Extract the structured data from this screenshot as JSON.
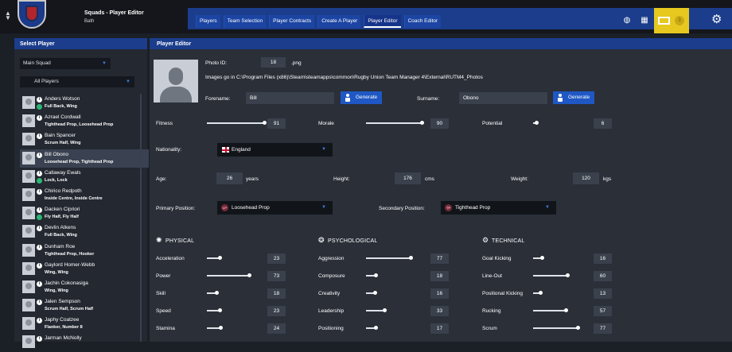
{
  "header": {
    "title": "Squads - Player Editor",
    "subtitle": "Bath"
  },
  "tabs": [
    {
      "label": "Players"
    },
    {
      "label": "Team Selection"
    },
    {
      "label": "Player Contracts"
    },
    {
      "label": "Create A Player"
    },
    {
      "label": "Player Editor"
    },
    {
      "label": "Coach Editor"
    }
  ],
  "notifications": {
    "count": "3"
  },
  "left_panel": {
    "title": "Select Player",
    "squad_select": "Main Squad",
    "filter_select": "All Players",
    "players": [
      {
        "name": "Anders Wotson",
        "positions": "Full Back, Wing"
      },
      {
        "name": "Azrael Cordwall",
        "positions": "Tighthead Prop, Loosehead Prop"
      },
      {
        "name": "Bain Spancer",
        "positions": "Scrum Half, Wing"
      },
      {
        "name": "Bill Obono",
        "positions": "Loosehead Prop, Tighthead Prop"
      },
      {
        "name": "Callaway Ewals",
        "positions": "Lock, Lock"
      },
      {
        "name": "Chirico Redpoth",
        "positions": "Inside Centre, Inside Centre"
      },
      {
        "name": "Dacken Cipriori",
        "positions": "Fly Half, Fly Half"
      },
      {
        "name": "Devlin Atkens",
        "positions": "Full Back, Wing"
      },
      {
        "name": "Dunham Roe",
        "positions": "Tighthead Prop, Hooker"
      },
      {
        "name": "Gaylord Homer-Webb",
        "positions": "Wing, Wing"
      },
      {
        "name": "Jachin Cokonasiga",
        "positions": "Wing, Wing"
      },
      {
        "name": "Jalen Sempson",
        "positions": "Scrum Half, Scrum Half"
      },
      {
        "name": "Japhy Coatzee",
        "positions": "Flanker, Number 8"
      },
      {
        "name": "Jarman McNolly",
        "positions": ""
      }
    ]
  },
  "editor": {
    "title": "Player Editor",
    "photo_id_label": "Photo ID:",
    "photo_id": "18",
    "photo_ext": ".png",
    "images_note": "Images go in C:\\Program Files (x86)\\Steam\\steamapps\\common\\Rugby Union Team Manager 4\\External\\RUTM4_Photos",
    "forename_label": "Forename:",
    "forename": "Bill",
    "surname_label": "Surname:",
    "surname": "Obono",
    "generate_label": "Generate",
    "fitness_label": "Fitness",
    "fitness": 91,
    "morale_label": "Morale",
    "morale": 90,
    "potential_label": "Potential",
    "potential": 6,
    "nationality_label": "Nationality:",
    "nationality": "England",
    "age_label": "Age:",
    "age": "26",
    "age_unit": "years",
    "height_label": "Height:",
    "height": "176",
    "height_unit": "cms",
    "weight_label": "Weight:",
    "weight": "120",
    "weight_unit": "kgs",
    "primary_label": "Primary Position:",
    "primary": "Loosehead Prop",
    "primary_badge": "LP",
    "secondary_label": "Secondary Position:",
    "secondary": "Tighthead Prop",
    "secondary_badge": "TP"
  },
  "attributes": {
    "physical": {
      "title": "PHYSICAL",
      "items": [
        {
          "label": "Acceleration",
          "value": 23
        },
        {
          "label": "Power",
          "value": 73
        },
        {
          "label": "Skill",
          "value": 18
        },
        {
          "label": "Speed",
          "value": 23
        },
        {
          "label": "Stamina",
          "value": 24
        }
      ]
    },
    "psychological": {
      "title": "PSYCHOLOGICAL",
      "items": [
        {
          "label": "Aggression",
          "value": 77
        },
        {
          "label": "Composure",
          "value": 18
        },
        {
          "label": "Creativity",
          "value": 16
        },
        {
          "label": "Leadership",
          "value": 33
        },
        {
          "label": "Positioning",
          "value": 17
        }
      ]
    },
    "technical": {
      "title": "TECHNICAL",
      "items": [
        {
          "label": "Goal Kicking",
          "value": 16
        },
        {
          "label": "Line-Out",
          "value": 60
        },
        {
          "label": "Positional Kicking",
          "value": 13
        },
        {
          "label": "Rucking",
          "value": 57
        },
        {
          "label": "Scrum",
          "value": 77
        }
      ]
    }
  }
}
